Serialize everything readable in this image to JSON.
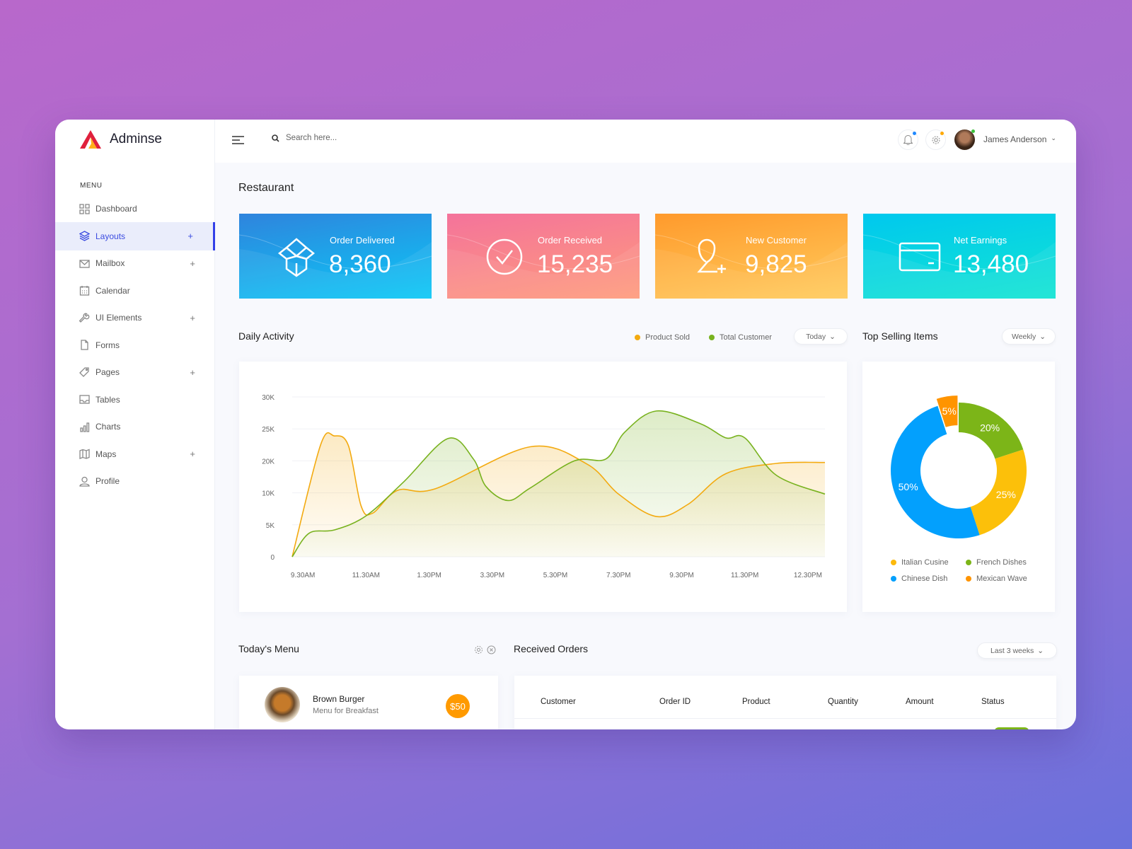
{
  "app": {
    "name": "Adminse"
  },
  "sidebar": {
    "heading": "MENU",
    "items": [
      {
        "label": "Dashboard",
        "icon": "grid-icon",
        "expandable": false
      },
      {
        "label": "Layouts",
        "icon": "layers-icon",
        "expandable": true,
        "active": true
      },
      {
        "label": "Mailbox",
        "icon": "mail-icon",
        "expandable": true
      },
      {
        "label": "Calendar",
        "icon": "calendar-icon",
        "expandable": false
      },
      {
        "label": "UI Elements",
        "icon": "wrench-icon",
        "expandable": true
      },
      {
        "label": "Forms",
        "icon": "file-icon",
        "expandable": false
      },
      {
        "label": "Pages",
        "icon": "tag-icon",
        "expandable": true
      },
      {
        "label": "Tables",
        "icon": "inbox-icon",
        "expandable": false
      },
      {
        "label": "Charts",
        "icon": "bar-chart-icon",
        "expandable": false
      },
      {
        "label": "Maps",
        "icon": "map-icon",
        "expandable": true
      },
      {
        "label": "Profile",
        "icon": "user-icon",
        "expandable": false
      }
    ],
    "plus": "+"
  },
  "header": {
    "search_placeholder": "Search here...",
    "user_name": "James Anderson",
    "notif_dot": "#1e88ff",
    "settings_dot": "#ffa800",
    "online_dot": "#3cc13b"
  },
  "page_title": "Restaurant",
  "stats": [
    {
      "label": "Order Delivered",
      "value": "8,360",
      "icon": "box-icon",
      "colors": [
        "#2f84dd",
        "#0bc8f6"
      ]
    },
    {
      "label": "Order Received",
      "value": "15,235",
      "icon": "check-circle-icon",
      "colors": [
        "#f4739b",
        "#fe9b7c"
      ]
    },
    {
      "label": "New Customer",
      "value": "9,825",
      "icon": "add-user-icon",
      "colors": [
        "#ff9a2c",
        "#ffcb5c"
      ]
    },
    {
      "label": "Net Earnings",
      "value": "13,480",
      "icon": "credit-card-icon",
      "colors": [
        "#00c8ee",
        "#13e4d3"
      ]
    }
  ],
  "daily": {
    "title": "Daily Activity",
    "filter": "Today"
  },
  "top_selling": {
    "title": "Top Selling Items",
    "filter": "Weekly"
  },
  "chart_data": [
    {
      "type": "area",
      "legend_placement": "top-right",
      "grid": true,
      "categories": [
        "9.30AM",
        "11.30AM",
        "1.30PM",
        "3.30PM",
        "5.30PM",
        "7.30PM",
        "9.30PM",
        "11.30PM",
        "12.30PM"
      ],
      "y_ticks": [
        0,
        5000,
        10000,
        20000,
        25000,
        30000
      ],
      "y_tick_labels": [
        "0",
        "5K",
        "10K",
        "20K",
        "25K",
        "30K"
      ],
      "series": [
        {
          "name": "Product Sold",
          "color": "#f3aa10",
          "points": [
            [
              -0.17,
              0
            ],
            [
              0.28,
              22500
            ],
            [
              0.5,
              23900
            ],
            [
              0.72,
              22400
            ],
            [
              0.92,
              8000
            ],
            [
              1.1,
              6800
            ],
            [
              1.5,
              10800
            ],
            [
              2.1,
              11300
            ],
            [
              3.6,
              22200
            ],
            [
              4.5,
              19000
            ],
            [
              5.0,
              9800
            ],
            [
              5.6,
              6300
            ],
            [
              6.1,
              8200
            ],
            [
              6.7,
              16000
            ],
            [
              7.5,
              19200
            ],
            [
              8.27,
              19500
            ]
          ]
        },
        {
          "name": "Total Customer",
          "color": "#78b21e",
          "points": [
            [
              -0.17,
              0
            ],
            [
              0.1,
              3700
            ],
            [
              0.5,
              4200
            ],
            [
              1.0,
              6400
            ],
            [
              1.6,
              13500
            ],
            [
              2.3,
              23500
            ],
            [
              2.7,
              20300
            ],
            [
              2.9,
              12000
            ],
            [
              3.25,
              8800
            ],
            [
              3.6,
              11500
            ],
            [
              4.3,
              20000
            ],
            [
              4.8,
              20300
            ],
            [
              5.1,
              24500
            ],
            [
              5.6,
              27800
            ],
            [
              6.3,
              25800
            ],
            [
              6.7,
              23600
            ],
            [
              7.0,
              23600
            ],
            [
              7.5,
              15500
            ],
            [
              8.27,
              9800
            ]
          ]
        }
      ]
    },
    {
      "type": "pie",
      "donut": true,
      "slices": [
        {
          "name": "French Dishes",
          "value": 20,
          "label": "20%",
          "color": "#7cb518"
        },
        {
          "name": "Italian Cusine",
          "value": 25,
          "label": "25%",
          "color": "#fcc00a"
        },
        {
          "name": "Chinese Dish",
          "value": 50,
          "label": "50%",
          "color": "#03a0fd"
        },
        {
          "name": "Mexican Wave",
          "value": 5,
          "label": "5%",
          "color": "#ff9400",
          "exploded": true
        }
      ],
      "legend": [
        "Italian Cusine",
        "French Dishes",
        "Chinese Dish",
        "Mexican Wave"
      ],
      "legend_colors": [
        "#fcb90c",
        "#7cb518",
        "#03a0fd",
        "#ff9400"
      ]
    }
  ],
  "menu": {
    "title": "Today's Menu",
    "items": [
      {
        "name": "Brown Burger",
        "subtitle": "Menu for Breakfast",
        "price": "$50"
      }
    ]
  },
  "orders": {
    "title": "Received Orders",
    "filter": "Last 3 weeks",
    "columns": [
      "Customer",
      "Order ID",
      "Product",
      "Quantity",
      "Amount",
      "Status"
    ]
  }
}
